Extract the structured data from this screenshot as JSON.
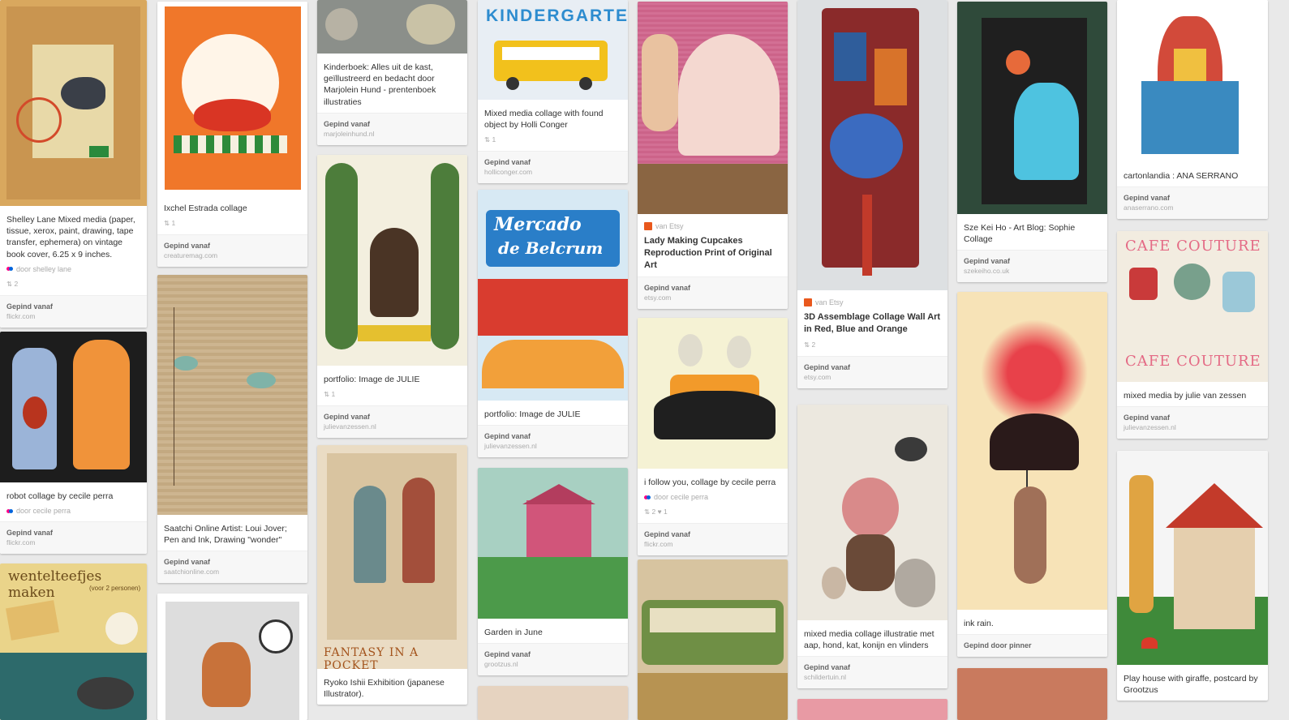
{
  "pins": [
    {
      "id": "p1",
      "desc": "Shelley Lane Mixed media (paper, tissue, xerox, paint, drawing, tape transfer, ephemera) on vintage book cover, 6.25 x 9 inches.",
      "attrib": "door shelley lane",
      "stats": "2",
      "via": "Gepind vanaf",
      "source": "flickr.com"
    },
    {
      "id": "p2",
      "desc": "robot collage by cecile perra",
      "attrib": "door cecile perra",
      "via": "Gepind vanaf",
      "source": "flickr.com"
    },
    {
      "id": "p4",
      "desc": "Ixchel Estrada collage",
      "stats": "1",
      "via": "Gepind vanaf",
      "source": "creaturemag.com"
    },
    {
      "id": "p5",
      "desc": "Saatchi Online Artist: Loui Jover; Pen and Ink, Drawing \"wonder\"",
      "via": "Gepind vanaf",
      "source": "saatchionline.com"
    },
    {
      "id": "p7",
      "desc": "Kinderboek: Alles uit de kast, geïllustreerd en bedacht door Marjolein Hund - prentenboek illustraties",
      "via": "Gepind vanaf",
      "source": "marjoleinhund.nl"
    },
    {
      "id": "p8",
      "desc": "portfolio: Image de JULIE",
      "stats": "1",
      "via": "Gepind vanaf",
      "source": "julievanzessen.nl"
    },
    {
      "id": "p9",
      "desc": "Ryoko Ishii Exhibition (japanese Illustrator).",
      "poster_text": "FANTASY IN A POCKET"
    },
    {
      "id": "p10",
      "desc": "Mixed media collage with found object by Holli Conger",
      "stats": "1",
      "via": "Gepind vanaf",
      "source": "holliconger.com",
      "poster_text": "KINDERGARTEN"
    },
    {
      "id": "p11",
      "desc": "portfolio: Image de JULIE",
      "via": "Gepind vanaf",
      "source": "julievanzessen.nl",
      "poster_title1": "Mercado",
      "poster_title2": "de Belcrum"
    },
    {
      "id": "p12",
      "desc": "Garden in June",
      "via": "Gepind vanaf",
      "source": "grootzus.nl"
    },
    {
      "id": "p14",
      "vendor": "van Etsy",
      "desc": "Lady Making Cupcakes Reproduction Print of Original Art",
      "via": "Gepind vanaf",
      "source": "etsy.com"
    },
    {
      "id": "p15",
      "desc": "i follow you, collage by cecile perra",
      "attrib": "door cecile perra",
      "stats": "2",
      "likes": "1",
      "via": "Gepind vanaf",
      "source": "flickr.com"
    },
    {
      "id": "p17",
      "vendor": "van Etsy",
      "desc": "3D Assemblage Collage Wall Art in Red, Blue and Orange",
      "stats": "2",
      "via": "Gepind vanaf",
      "source": "etsy.com"
    },
    {
      "id": "p18",
      "desc": "mixed media collage illustratie met aap, hond, kat, konijn en vlinders",
      "via": "Gepind vanaf",
      "source": "schildertuin.nl"
    },
    {
      "id": "p20",
      "desc": "Sze Kei Ho - Art Blog: Sophie Collage",
      "via": "Gepind vanaf",
      "source": "szekeiho.co.uk"
    },
    {
      "id": "p21",
      "desc": "ink rain.",
      "via": "Gepind door pinner"
    },
    {
      "id": "p23",
      "desc": "cartonlandia : ANA SERRANO",
      "via": "Gepind vanaf",
      "source": "anaserrano.com"
    },
    {
      "id": "p24",
      "desc": "mixed media by julie van zessen",
      "via": "Gepind vanaf",
      "source": "julievanzessen.nl",
      "poster_text": "CAFE COUTURE"
    },
    {
      "id": "p25",
      "desc": "Play house with giraffe, postcard by Grootzus"
    }
  ],
  "p3_poster": {
    "title": "wentelteefjes maken",
    "subtitle": "(voor 2 personen)"
  },
  "colors": {
    "background": "#e9e9e9",
    "card": "#ffffff",
    "etsy": "#e9581d",
    "flickr_pink": "#ff0084",
    "flickr_blue": "#0063dc"
  }
}
